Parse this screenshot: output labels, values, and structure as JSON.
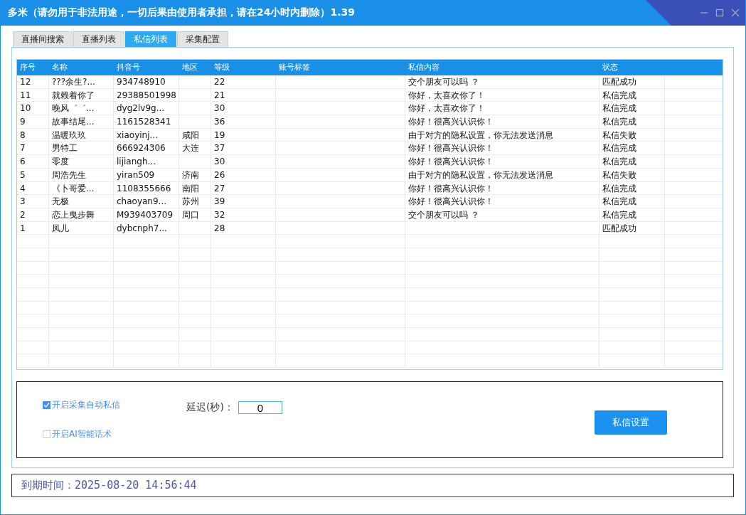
{
  "window": {
    "title": "多米（请勿用于非法用途，一切后果由使用者承担，请在24小时内删除）1.39"
  },
  "tabs": [
    {
      "label": "直播间搜索",
      "selected": false
    },
    {
      "label": "直播列表",
      "selected": false
    },
    {
      "label": "私信列表",
      "selected": true
    },
    {
      "label": "采集配置",
      "selected": false
    }
  ],
  "table": {
    "columns": [
      "序号",
      "名称",
      "抖音号",
      "地区",
      "等级",
      "账号标签",
      "私信内容",
      "状态"
    ],
    "rows": [
      [
        "12",
        "???余生?...",
        "934748910",
        "",
        "22",
        "",
        "交个朋友可以吗 ？",
        "匹配成功"
      ],
      [
        "11",
        "就赖着你了",
        "29388501998",
        "",
        "21",
        "",
        "你好，太喜欢你了！",
        "私信完成"
      ],
      [
        "10",
        "晚风゛゛...",
        "dyg2lv9g...",
        "",
        "30",
        "",
        "你好，太喜欢你了！",
        "私信完成"
      ],
      [
        "9",
        "故事结尾...",
        "1161528341",
        "",
        "36",
        "",
        "你好！很高兴认识你！",
        "私信完成"
      ],
      [
        "8",
        "温暖玖玖",
        "xiaoyinj...",
        "咸阳",
        "19",
        "",
        "由于对方的隐私设置，你无法发送消息",
        "私信失败"
      ],
      [
        "7",
        "男特工",
        "666924306",
        "大连",
        "37",
        "",
        "你好！很高兴认识你！",
        "私信完成"
      ],
      [
        "6",
        "零度",
        "lijiangh...",
        "",
        "30",
        "",
        "你好！很高兴认识你！",
        "私信完成"
      ],
      [
        "5",
        "周浩先生",
        "yiran509",
        "济南",
        "26",
        "",
        "由于对方的隐私设置，你无法发送消息",
        "私信失败"
      ],
      [
        "4",
        "《卜哥爱...",
        "1108355666",
        "南阳",
        "27",
        "",
        "你好！很高兴认识你！",
        "私信完成"
      ],
      [
        "3",
        "无极",
        "chaoyan9...",
        "苏州",
        "39",
        "",
        "你好！很高兴认识你！",
        "私信完成"
      ],
      [
        "2",
        "恋上曳步舞",
        "M939403709",
        "周口",
        "32",
        "",
        "交个朋友可以吗 ？",
        "私信完成"
      ],
      [
        "1",
        "凤儿",
        "dybcnph7...",
        "",
        "28",
        "",
        "",
        "匹配成功"
      ]
    ]
  },
  "options": [
    {
      "label": "开启采集自动私信",
      "checked": true
    },
    {
      "label": "开启AI智能话术",
      "checked": false
    }
  ],
  "delay": {
    "label": "延迟(秒)：",
    "value": "0"
  },
  "settings_button": "私信设置",
  "status_bar": {
    "expiry": "到期时间：2025-08-20 14:56:44"
  }
}
